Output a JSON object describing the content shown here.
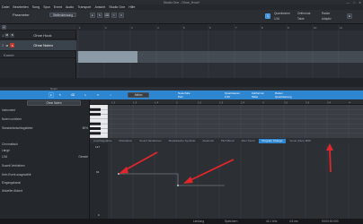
{
  "window": {
    "title": "Studio One - Ohne_Hook*",
    "controls": [
      "—",
      "□",
      "✕"
    ]
  },
  "menu": [
    "Datei",
    "Bearbeiten",
    "Song",
    "Spur",
    "Event",
    "Audio",
    "Transport",
    "Ansicht",
    "Studio One",
    "Hilfe"
  ],
  "topbar": {
    "parameter_label": "Parameter",
    "parameter_value": "Stellenkennung",
    "quantize_label": "Quantisieren",
    "quantize_value": "1/16",
    "timebase_label": "Zeitformat",
    "timebase_value": "Takte",
    "snap_label": "Raster",
    "snap_value": "Adaptiv"
  },
  "tracks": [
    {
      "num": "1",
      "name": "Ohne Hook",
      "muted": "M",
      "solo": "S",
      "color": "#7a7f86"
    },
    {
      "num": "2",
      "name": "Ohne Noten",
      "muted": "M",
      "solo": "S",
      "color": "#2e86d1"
    },
    {
      "num": "",
      "name": "Kamer",
      "muted": "",
      "solo": "",
      "color": "#7a7f86"
    }
  ],
  "ruler_marks": [
    "1",
    "2",
    "3",
    "4",
    "5",
    "6",
    "7",
    "8",
    "9",
    "10",
    "11"
  ],
  "editor": {
    "tool_label": "Aktion",
    "note_label": "Notenfolie",
    "note_value": "Part",
    "quantize_label": "Quantisieren",
    "quantize_value": "1/16",
    "timebase_label": "Zeitformat",
    "timebase_value": "Takte",
    "snap_label": "Raster",
    "snap_value": "Quantisierung",
    "ruler": [
      "1.2",
      "1.3",
      "1.4",
      "2",
      "2.2",
      "2.3",
      "2.4",
      "3",
      "3.2",
      "3.3",
      "3.4",
      "4"
    ]
  },
  "inspector": {
    "track_name": "Ohne Noten",
    "rows": [
      {
        "label": "Instrument",
        "value": ""
      },
      {
        "label": "Noten vorhören",
        "value": ""
      },
      {
        "label": "Standardanschlagstärke",
        "value": "80%"
      },
      {
        "label": "Chromatisch",
        "value": ""
      },
      {
        "label": "Länge",
        "value": ""
      },
      {
        "label": "1/16",
        "value": "Gerade"
      },
      {
        "label": "Soweit Verbleiben",
        "value": ""
      },
      {
        "label": "Kein Event ausgewählt",
        "value": ""
      },
      {
        "label": "Eingangskanal",
        "value": ""
      },
      {
        "label": "Aktueller Akkord",
        "value": ""
      }
    ]
  },
  "control_tabs": [
    "Anschlagstärke",
    "Modulation",
    "Sound Variationen",
    "Musikalische Symbole",
    "Ausdruck",
    "Pitch Bend",
    "After Touch",
    "Program Change",
    "Sonst (Inter) MIDI"
  ],
  "control_tab_selected": 7,
  "lane_labels": [
    "127",
    "64",
    "0"
  ],
  "status": {
    "items": [
      "Noten",
      "Mixer",
      "Browser"
    ],
    "samplerate": "44.1 kHz",
    "latency": "4.6 ms",
    "time": "00:00:00.000",
    "cpu": "Leistung",
    "save": "Speichern"
  }
}
